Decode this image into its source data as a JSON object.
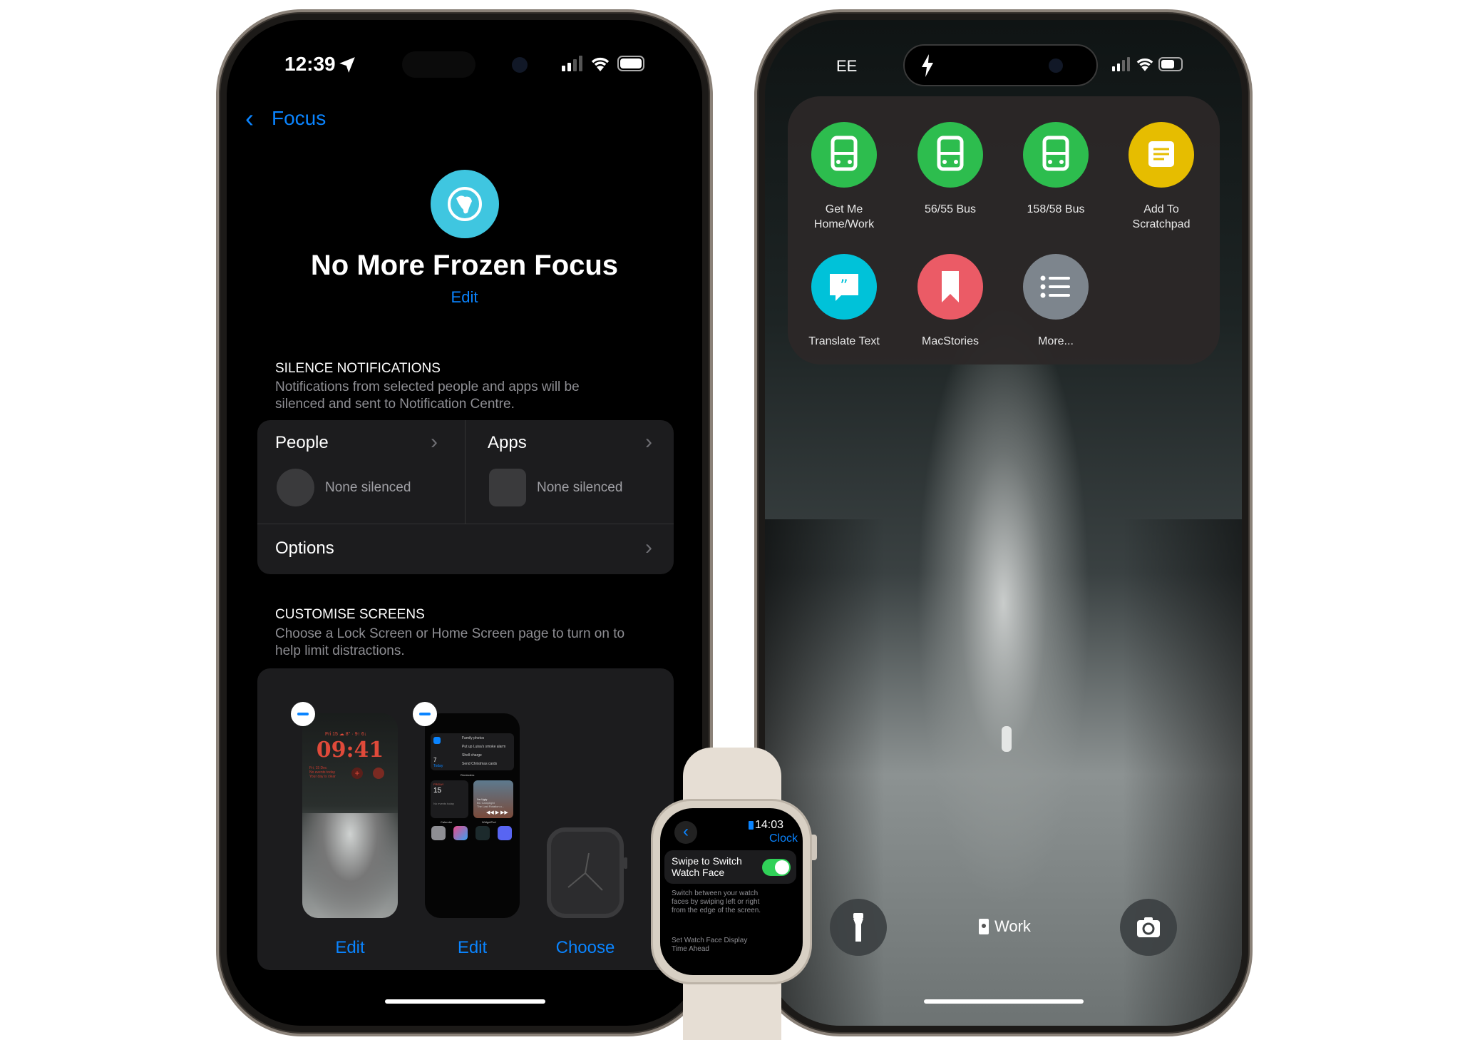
{
  "left_phone": {
    "status": {
      "time": "12:39"
    },
    "nav": {
      "back_label": "Focus"
    },
    "focus": {
      "title": "No More Frozen Focus",
      "edit_label": "Edit",
      "icon": "globe-icon",
      "icon_color": "#3fc6e0"
    },
    "silence": {
      "header": "SILENCE NOTIFICATIONS",
      "description_line1": "Notifications from selected people and apps will be",
      "description_line2": "silenced and sent to Notification Centre.",
      "people_label": "People",
      "people_value": "None silenced",
      "apps_label": "Apps",
      "apps_value": "None silenced",
      "options_label": "Options"
    },
    "customise": {
      "header": "CUSTOMISE SCREENS",
      "description_line1": "Choose a Lock Screen or Home Screen page to turn on to",
      "description_line2": "help limit distractions.",
      "lock_screen": {
        "date_weather": "Fri 15 ☁ 8° · 9↑ 6↓",
        "time": "09:41",
        "line1": "Fri, 15 Dec",
        "line2": "No events today",
        "line3": "Your day is clear",
        "edit_label": "Edit"
      },
      "home_screen": {
        "reminders": [
          "Family photos",
          "Put up Luisa's smoke alarm",
          "Shell charge",
          "Send Christmas cards"
        ],
        "reminders_count": "7",
        "reminders_today": "Today",
        "reminders_widget": "Reminders",
        "calendar_day": "FRIDAY",
        "calendar_date": "15",
        "calendar_events": "No events today",
        "calendar_widget": "Calendar",
        "music_title": "I'm Ugly",
        "music_artist": "BC Camplight",
        "music_album": "The Last Rotation o...",
        "music_widget": "WidgetPod",
        "edit_label": "Edit"
      },
      "watch_face": {
        "choose_label": "Choose"
      }
    }
  },
  "right_phone": {
    "status": {
      "carrier": "EE"
    },
    "shortcuts": [
      {
        "label_line1": "Get Me",
        "label_line2": "Home/Work",
        "icon": "bus-icon",
        "color": "#2dbd4e"
      },
      {
        "label_line1": "56/55 Bus",
        "label_line2": "",
        "icon": "bus-icon",
        "color": "#2dbd4e"
      },
      {
        "label_line1": "158/58 Bus",
        "label_line2": "",
        "icon": "bus-icon",
        "color": "#2dbd4e"
      },
      {
        "label_line1": "Add To",
        "label_line2": "Scratchpad",
        "icon": "note-icon",
        "color": "#e6bd00"
      },
      {
        "label_line1": "Translate Text",
        "label_line2": "",
        "icon": "quote-bubble-icon",
        "color": "#00c2d9"
      },
      {
        "label_line1": "MacStories",
        "label_line2": "",
        "icon": "bookmark-icon",
        "color": "#eb5b66"
      },
      {
        "label_line1": "More...",
        "label_line2": "",
        "icon": "list-icon",
        "color": "#7d858d"
      }
    ],
    "focus_label": "Work"
  },
  "watch": {
    "time": "14:03",
    "title": "Clock",
    "toggle_label_line1": "Swipe to Switch",
    "toggle_label_line2": "Watch Face",
    "toggle_on": true,
    "description_line1": "Switch between your watch",
    "description_line2": "faces by swiping left or right",
    "description_line3": "from the edge of the screen.",
    "next_line1": "Set Watch Face Display",
    "next_line2": "Time Ahead",
    "toggle_color": "#30d158"
  }
}
